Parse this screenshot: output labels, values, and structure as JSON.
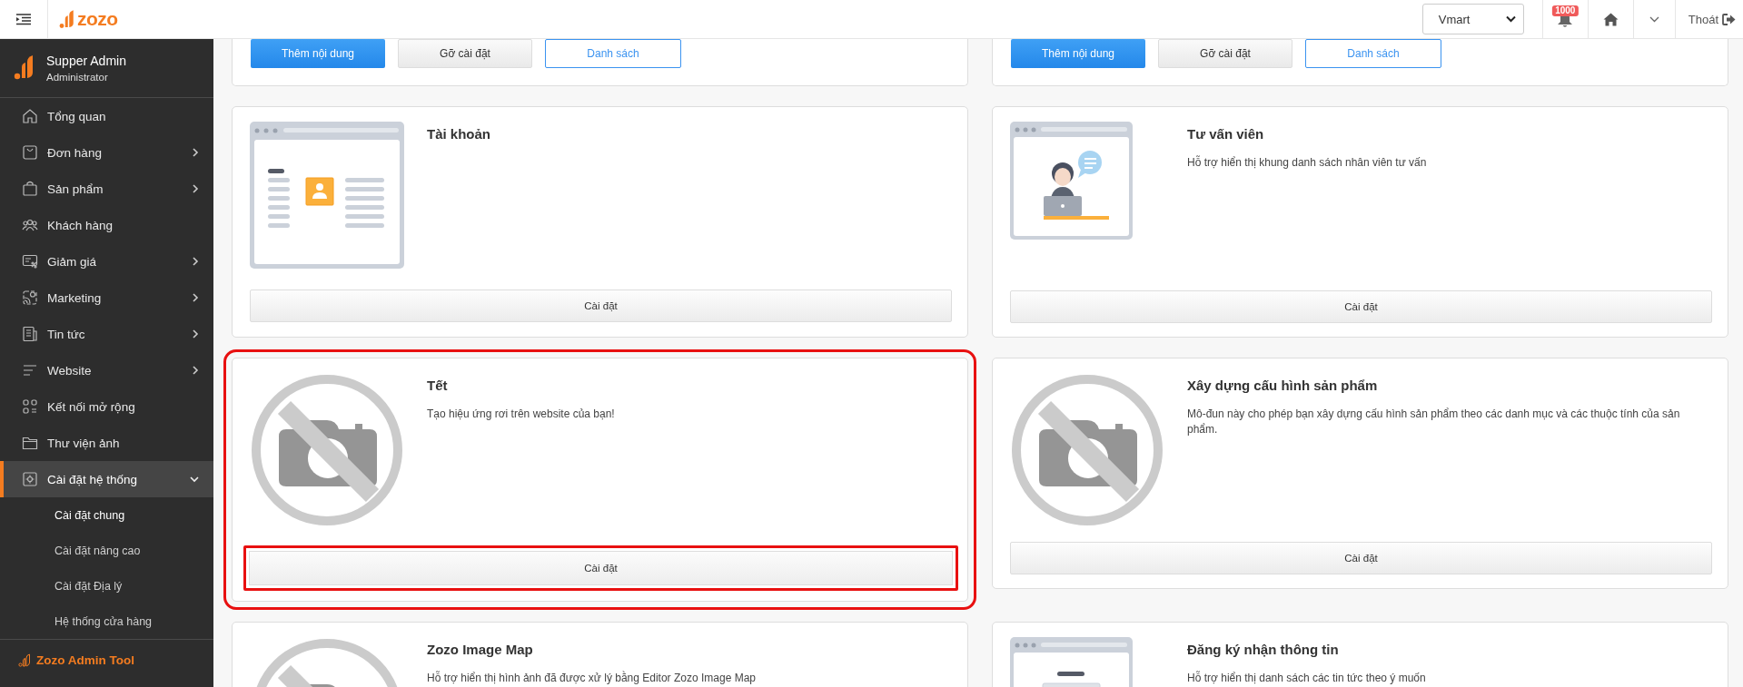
{
  "topbar": {
    "logo": "zozo",
    "store_select": {
      "value": "Vmart"
    },
    "notifications": {
      "badge": "1000"
    },
    "logout": "Thoát"
  },
  "sidebar": {
    "user": {
      "name": "Supper Admin",
      "role": "Administrator"
    },
    "items": [
      {
        "label": "Tổng quan",
        "has_submenu": false,
        "selected": false
      },
      {
        "label": "Đơn hàng",
        "has_submenu": true,
        "expanded": false,
        "selected": false
      },
      {
        "label": "Sản phẩm",
        "has_submenu": true,
        "expanded": false,
        "selected": false
      },
      {
        "label": "Khách hàng",
        "has_submenu": false,
        "selected": false
      },
      {
        "label": "Giảm giá",
        "has_submenu": true,
        "expanded": false,
        "selected": false
      },
      {
        "label": "Marketing",
        "has_submenu": true,
        "expanded": false,
        "selected": false
      },
      {
        "label": "Tin tức",
        "has_submenu": true,
        "expanded": false,
        "selected": false
      },
      {
        "label": "Website",
        "has_submenu": true,
        "expanded": false,
        "selected": false
      },
      {
        "label": "Kết nối mở rộng",
        "has_submenu": false,
        "selected": false
      },
      {
        "label": "Thư viện ảnh",
        "has_submenu": false,
        "selected": false
      },
      {
        "label": "Cài đặt hệ thống",
        "has_submenu": true,
        "expanded": true,
        "selected": true,
        "children": [
          {
            "label": "Cài đặt chung",
            "selected": true
          },
          {
            "label": "Cài đặt nâng cao",
            "selected": false
          },
          {
            "label": "Cài đặt Địa lý",
            "selected": false
          },
          {
            "label": "Hệ thống cửa hàng",
            "selected": false
          }
        ]
      }
    ],
    "footer": "Zozo Admin Tool"
  },
  "content": {
    "top_cards": [
      {
        "buttons": [
          {
            "label": "Thêm nội dung",
            "kind": "primary"
          },
          {
            "label": "Gỡ cài đặt",
            "kind": "default"
          },
          {
            "label": "Danh sách",
            "kind": "outline"
          }
        ]
      },
      {
        "buttons": [
          {
            "label": "Thêm nội dung",
            "kind": "primary"
          },
          {
            "label": "Gỡ cài đặt",
            "kind": "default"
          },
          {
            "label": "Danh sách",
            "kind": "outline"
          }
        ]
      }
    ],
    "cards": [
      {
        "title": "Tài khoản",
        "kind": "account",
        "button": "Cài đặt",
        "highlighted": false,
        "button_highlighted": false
      },
      {
        "title": "Tư vấn viên",
        "description": "Hỗ trợ hiển thị khung danh sách nhân viên tư vấn",
        "kind": "consultant",
        "button": "Cài đặt",
        "highlighted": false,
        "button_highlighted": false
      },
      {
        "title": "Tết",
        "description": "Tạo hiệu ứng rơi trên website của bạn!",
        "kind": "no-image",
        "button": "Cài đặt",
        "highlighted": true,
        "button_highlighted": true
      },
      {
        "title": "Xây dựng cấu hình sản phẩm",
        "description": "Mô-đun này cho phép bạn xây dựng cấu hình sản phẩm theo các danh mục và các thuộc tính của sản phẩm.",
        "kind": "no-image",
        "button": "Cài đặt",
        "highlighted": false,
        "button_highlighted": false
      },
      {
        "title": "Zozo Image Map",
        "description": "Hỗ trợ hiển thị hình ảnh đã được xử lý bằng Editor Zozo Image Map",
        "kind": "no-image",
        "highlighted": false
      },
      {
        "title": "Đăng ký nhận thông tin",
        "description": "Hỗ trợ hiển thị danh sách các tin tức theo ý muốn",
        "kind": "newsletter",
        "highlighted": false
      }
    ]
  }
}
